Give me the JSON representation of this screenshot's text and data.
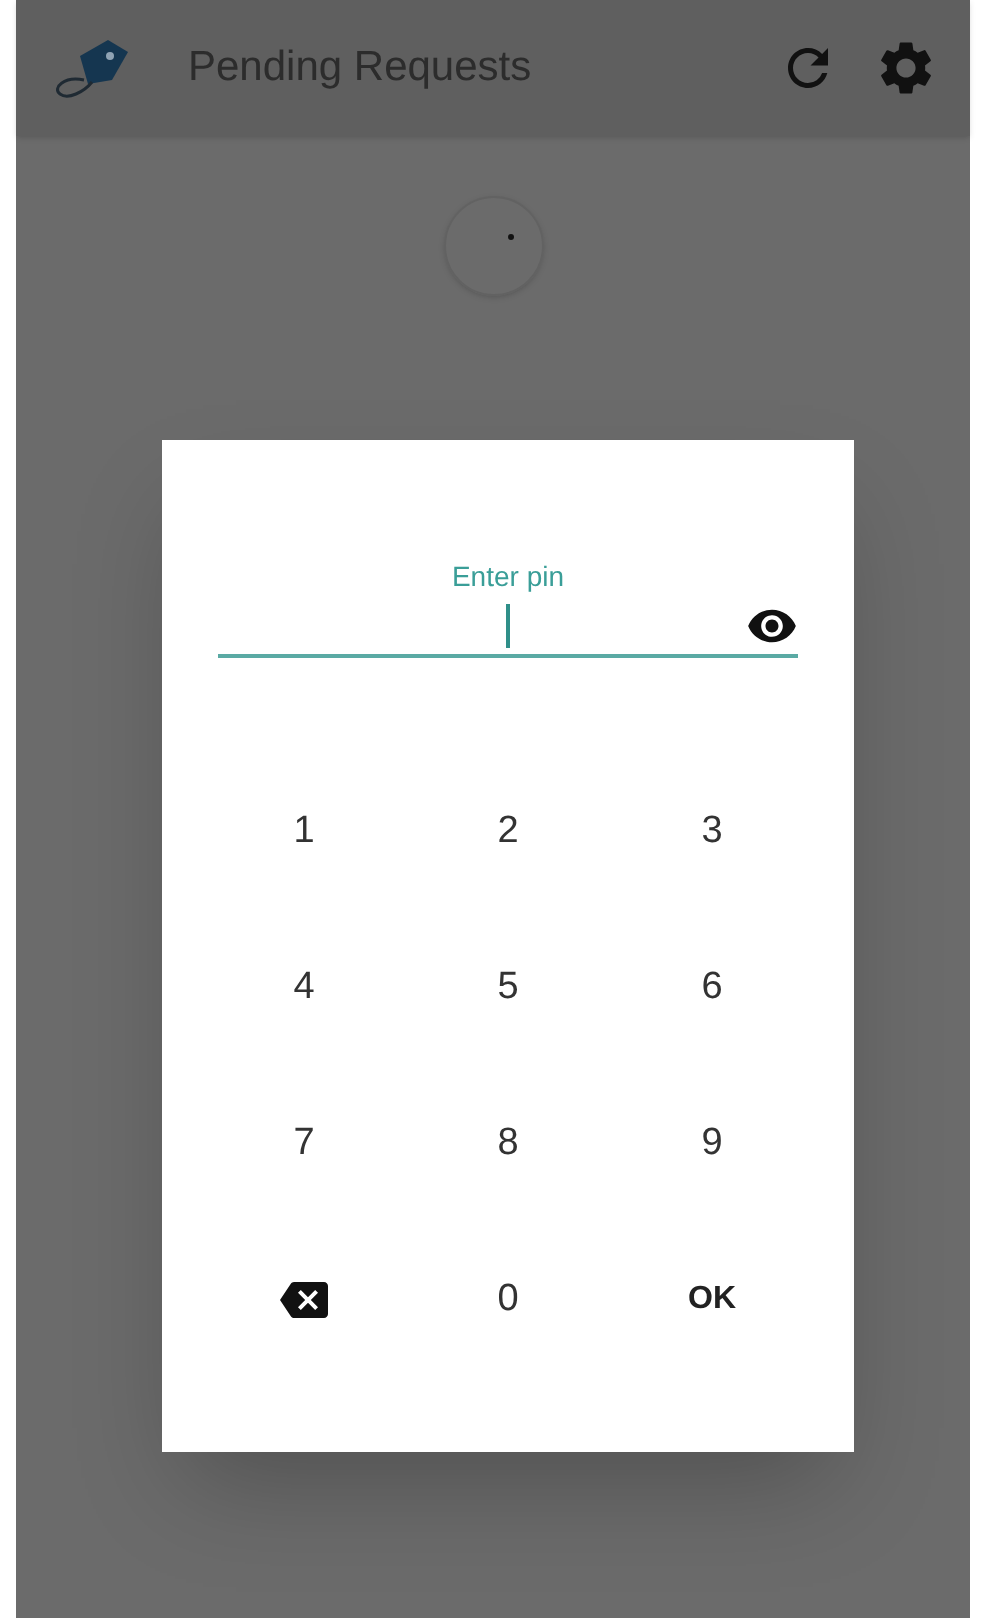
{
  "app_bar": {
    "title": "Pending Requests"
  },
  "pin_dialog": {
    "label": "Enter pin",
    "keys": [
      {
        "kind": "digit",
        "label": "1"
      },
      {
        "kind": "digit",
        "label": "2"
      },
      {
        "kind": "digit",
        "label": "3"
      },
      {
        "kind": "digit",
        "label": "4"
      },
      {
        "kind": "digit",
        "label": "5"
      },
      {
        "kind": "digit",
        "label": "6"
      },
      {
        "kind": "digit",
        "label": "7"
      },
      {
        "kind": "digit",
        "label": "8"
      },
      {
        "kind": "digit",
        "label": "9"
      },
      {
        "kind": "backspace"
      },
      {
        "kind": "digit",
        "label": "0"
      },
      {
        "kind": "ok",
        "label": "OK"
      }
    ]
  }
}
